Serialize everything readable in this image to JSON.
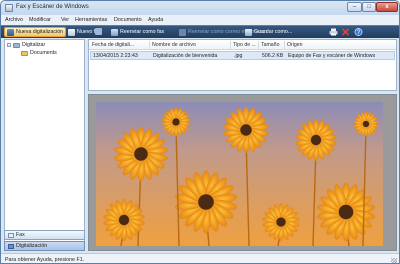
{
  "window": {
    "title": "Fax y Escáner de Windows",
    "controls": {
      "minimize": "–",
      "maximize": "□",
      "close": "x"
    }
  },
  "menu": [
    "Archivo",
    "Modificar",
    "Ver",
    "Herramientas",
    "Documento",
    "Ayuda"
  ],
  "toolbar": {
    "new_scan": "Nueva digitalización",
    "new_fax": "Nuevo fax",
    "forward_fax": "Reenviar como fax",
    "forward_email": "Reenviar como correo electrónico",
    "save_as": "Guardar como...",
    "print_icon": "printer-icon",
    "delete_icon": "delete-icon",
    "help_icon": "help-icon"
  },
  "tree": {
    "root": "Digitalizar",
    "child": "Documents"
  },
  "nav": {
    "fax": "Fax",
    "scan": "Digitalización"
  },
  "list": {
    "columns": [
      "Fecha de digitali...",
      "Nombre de archivo",
      "Tipo de ...",
      "Tamaño",
      "Origen"
    ],
    "rows": [
      {
        "date": "13/04/2015 2:23:43",
        "name": "Digitalización de bienvenida",
        "type": ".jpg",
        "size": "506.2 KB",
        "source": "Equipo de Fax y escáner de Windows"
      }
    ]
  },
  "preview": {
    "subject": "Orange gerbera daisies",
    "colors": {
      "petal": "#f29a14",
      "petal_light": "#ffc239",
      "center": "#4a2a12",
      "background_top": "#8c8cb8",
      "background_bottom": "#f0a040"
    }
  },
  "status": "Para obtener Ayuda, presione F1.",
  "colors": {
    "toolbar": "#2a4a70",
    "window_frame": "#dbe6f3",
    "selection": "#dde9f7",
    "highlight_button": "#f3c66a"
  }
}
